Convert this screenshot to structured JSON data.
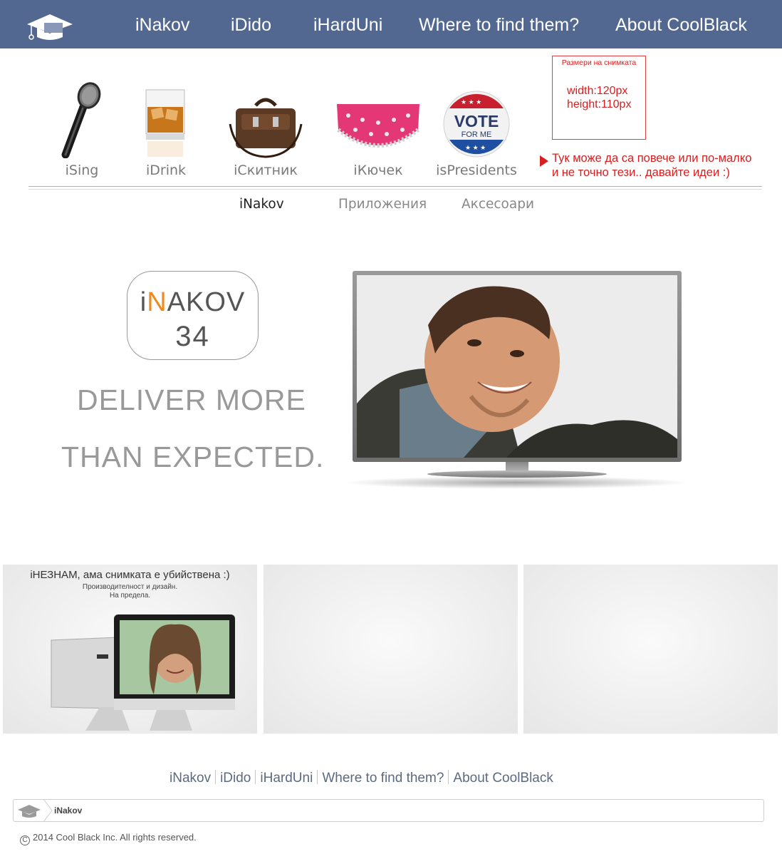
{
  "topnav": {
    "items": [
      "iNakov",
      "iDido",
      "iHardUni",
      "Where to find them?",
      "About CoolBlack"
    ]
  },
  "products": [
    {
      "label": "iSing",
      "icon": "microphone-icon"
    },
    {
      "label": "iDrink",
      "icon": "whisky-glass-icon"
    },
    {
      "label": "iСкитник",
      "icon": "leather-bag-icon"
    },
    {
      "label": "iКючек",
      "icon": "belly-dance-scarf-icon"
    },
    {
      "label": "isPresidents",
      "icon": "vote-button-icon"
    }
  ],
  "vote_badge": {
    "line1": "VOTE",
    "line2": "FOR ME"
  },
  "size_note": {
    "title": "Размери на снимката",
    "width": "width:120px",
    "height": "height:110px"
  },
  "idea_note": {
    "line1": "Тук може да са повече или по-малко",
    "line2": "и  не точно тези.. давайте идеи :)"
  },
  "subnav": {
    "items": [
      "iNakov",
      "Приложения",
      "Аксесоари"
    ],
    "active": "iNakov"
  },
  "hero": {
    "badge_prefix": "i",
    "badge_accent": "N",
    "badge_rest": "AKOV",
    "badge_number": "34",
    "slogan_line1": "DELIVER MORE",
    "slogan_line2": "THAN EXPECTED."
  },
  "cards": [
    {
      "title": "iНЕЗНАМ, ама снимката е убийствена :)",
      "sub1": "Производителност и дизайн.",
      "sub2": "На предела."
    },
    {
      "title": "",
      "sub1": "",
      "sub2": ""
    },
    {
      "title": "",
      "sub1": "",
      "sub2": ""
    }
  ],
  "footnav": {
    "items": [
      "iNakov",
      "iDido",
      "iHardUni",
      "Where to find them?",
      "About CoolBlack"
    ]
  },
  "breadcrumb": {
    "current": "iNakov"
  },
  "copyright": {
    "symbol": "C",
    "text": "2014 Cool Black Inc. All rights reserved."
  },
  "colors": {
    "nav_bg": "#536891",
    "accent": "#f08a1c",
    "note_red": "#d81e1e"
  }
}
